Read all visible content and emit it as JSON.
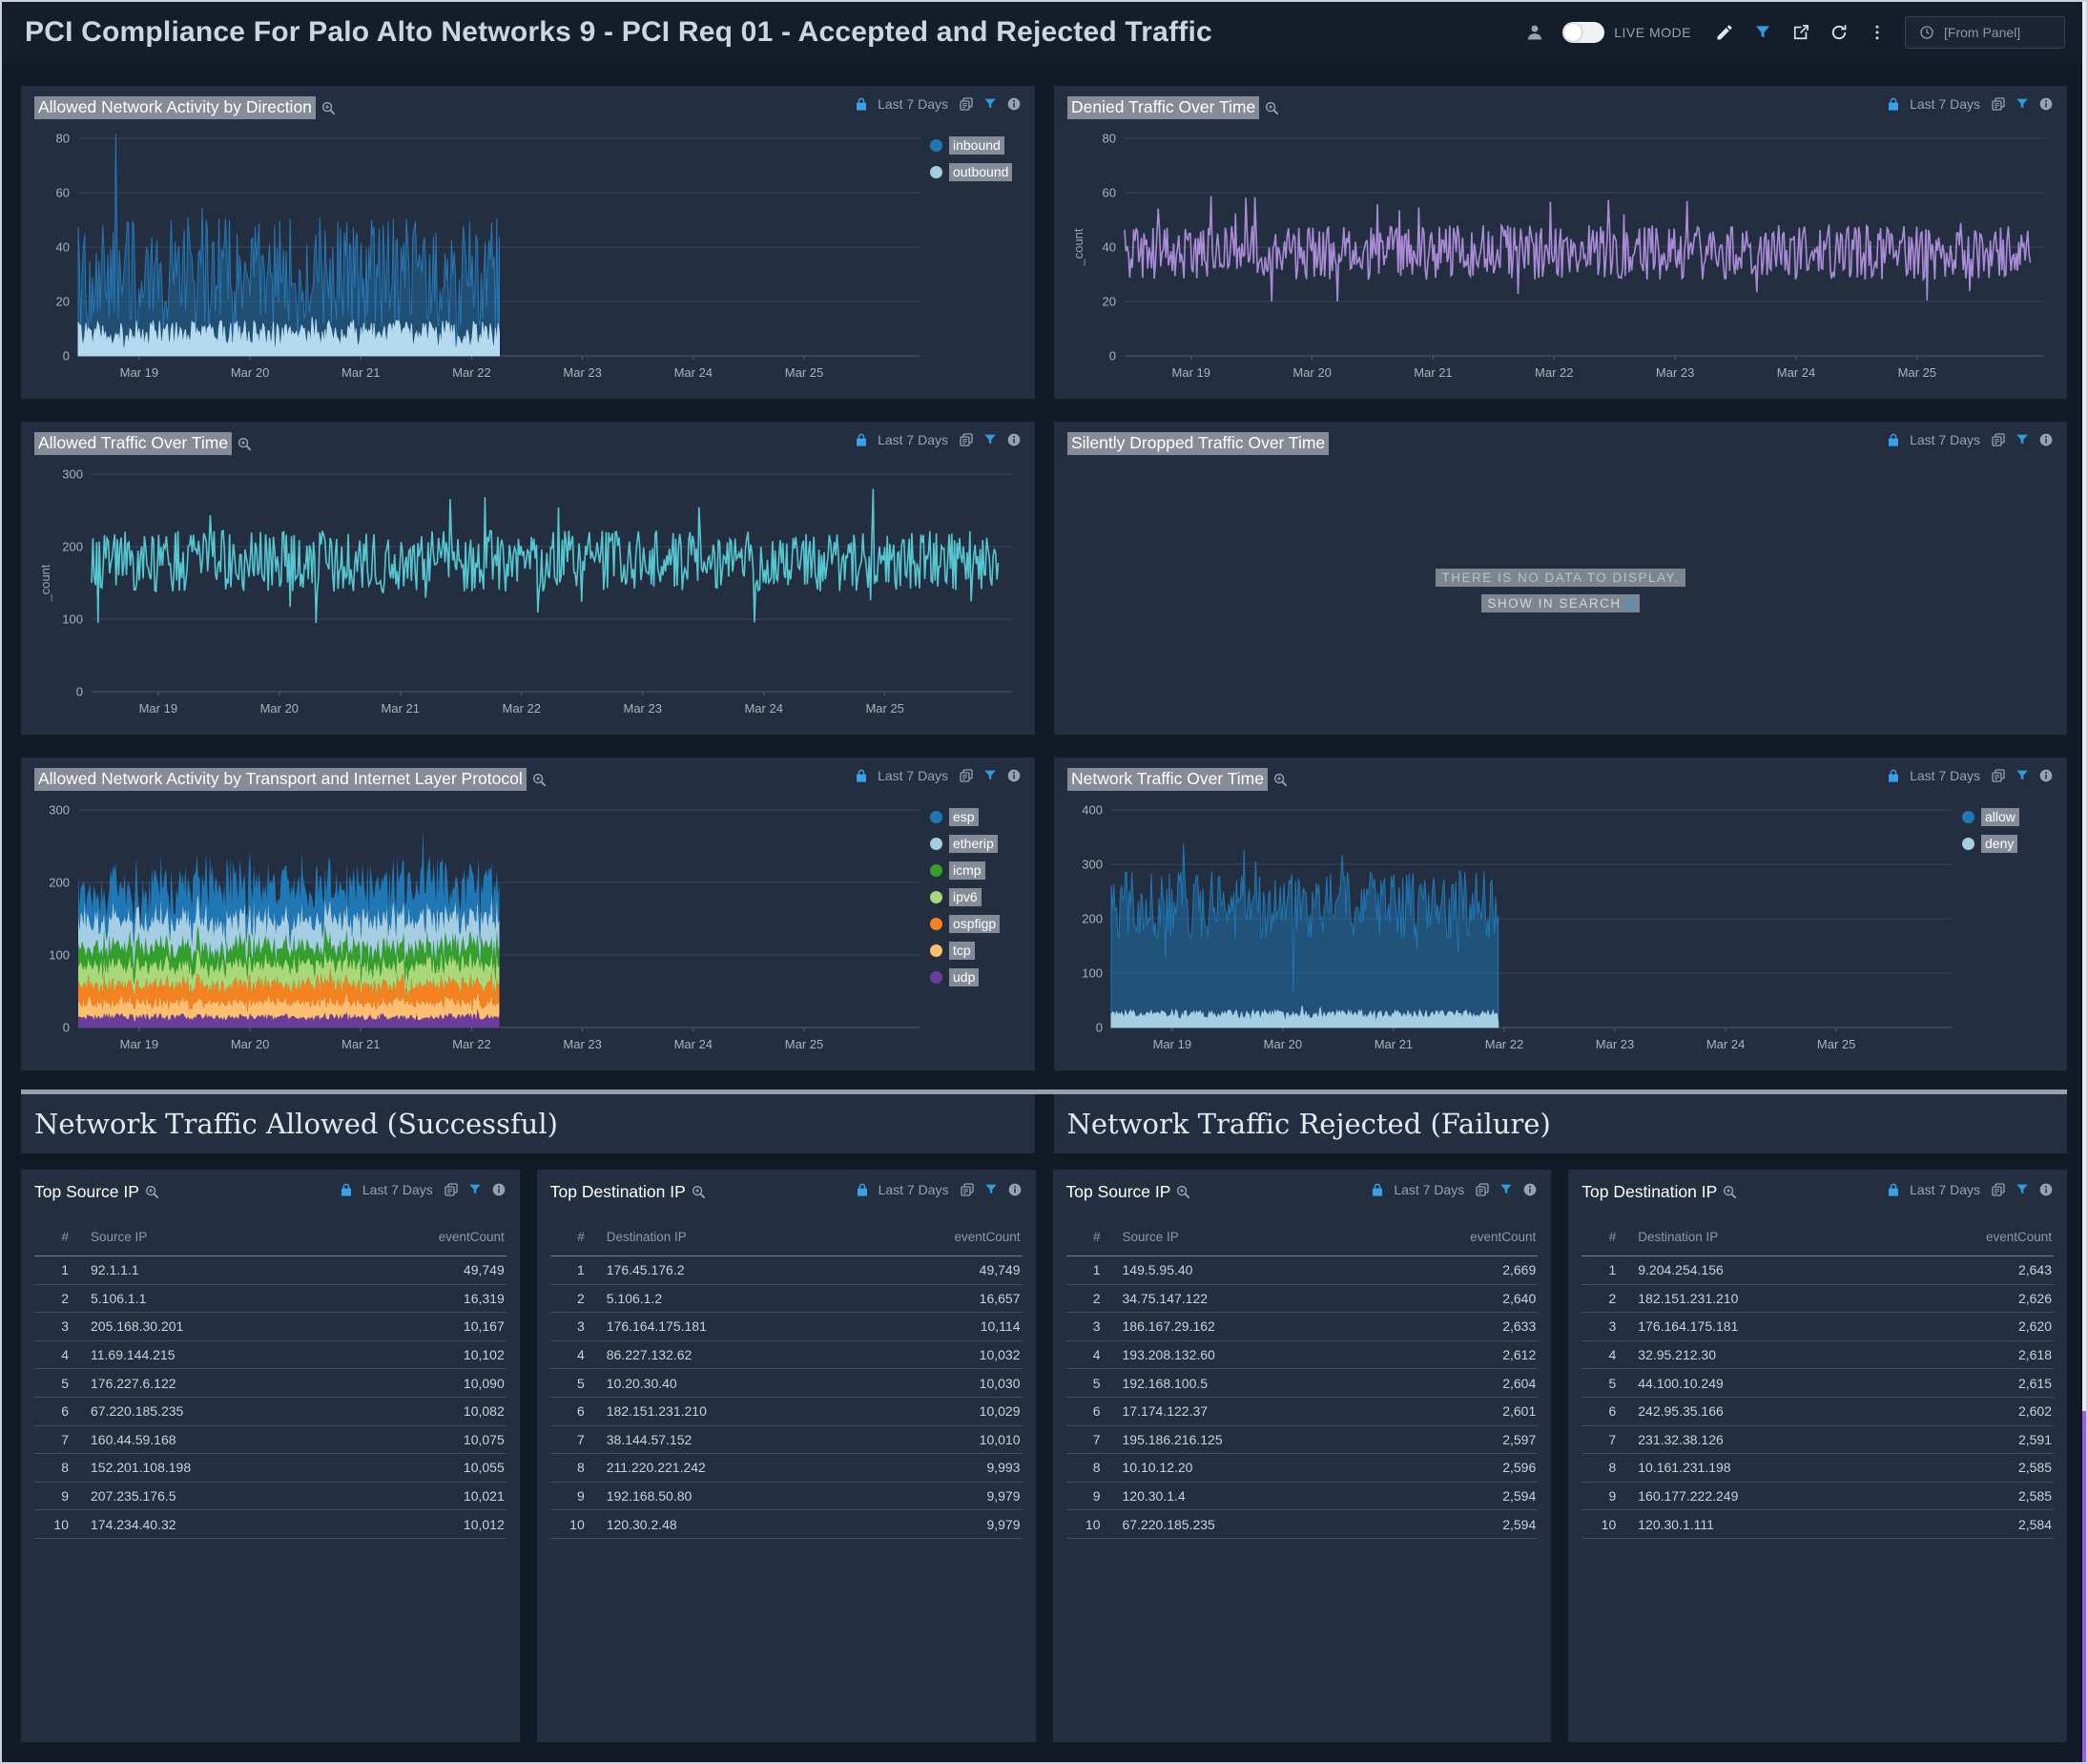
{
  "header": {
    "title": "PCI Compliance For Palo Alto Networks 9 - PCI Req 01 - Accepted and Rejected Traffic",
    "live_mode_label": "LIVE MODE",
    "time_input": "[From Panel]"
  },
  "theme": {
    "page_bg": "#121a27",
    "panel_bg": "#232e40",
    "accent_blue": "#2f9ee0",
    "highlight_gray": "#858c97",
    "scrollbar_thumb": "#9e5ce0"
  },
  "section_headers": [
    "Network Traffic Allowed (Successful)",
    "Network Traffic Rejected (Failure)"
  ],
  "chart_data": [
    {
      "title": "Allowed Network Activity by Direction",
      "time_range": "Last 7 Days",
      "type": "area",
      "x_ticks": [
        "Mar 19",
        "Mar 20",
        "Mar 21",
        "Mar 22",
        "Mar 23",
        "Mar 24",
        "Mar 25"
      ],
      "ylim": [
        0,
        80
      ],
      "yticks": [
        0,
        20,
        40,
        60,
        80
      ],
      "ylabel": "",
      "data_end_frac": 0.5,
      "note": "noisy traffic counts, data present Mar 19 through Mar 22 only, values mostly 5-65",
      "legend": [
        {
          "label": "inbound",
          "color": "#1f78b4"
        },
        {
          "label": "outbound",
          "color": "#a6cee3"
        }
      ],
      "render": "layers",
      "series": [
        {
          "name": "inbound",
          "style": "area",
          "color": "#2577b5",
          "fill": "rgba(31,120,180,0.45)",
          "mean": 30,
          "amp": 21,
          "min": 5,
          "seed": 11
        },
        {
          "name": "outbound",
          "style": "area",
          "color": "#b5d9ef",
          "fill": "#b5d9ef",
          "mean": 8,
          "amp": 5,
          "min": 2,
          "seed": 22
        }
      ]
    },
    {
      "title": "Denied Traffic Over Time",
      "time_range": "Last 7 Days",
      "type": "line",
      "x_ticks": [
        "Mar 19",
        "Mar 20",
        "Mar 21",
        "Mar 22",
        "Mar 23",
        "Mar 24",
        "Mar 25"
      ],
      "ylim": [
        0,
        80
      ],
      "yticks": [
        0,
        20,
        40,
        60,
        80
      ],
      "ylabel": "_count",
      "data_end_frac": 0.985,
      "note": "noisy purple line across full week, values mostly 20-65, mean ~38",
      "legend": [],
      "render": "layers",
      "series": [
        {
          "name": "_count",
          "style": "line",
          "color": "#a98bd6",
          "width": 1.6,
          "mean": 38,
          "amp": 10,
          "min": 20,
          "seed": 33
        }
      ]
    },
    {
      "title": "Allowed Traffic Over Time",
      "time_range": "Last 7 Days",
      "type": "line",
      "x_ticks": [
        "Mar 19",
        "Mar 20",
        "Mar 21",
        "Mar 22",
        "Mar 23",
        "Mar 24",
        "Mar 25"
      ],
      "ylim": [
        0,
        300
      ],
      "yticks": [
        0,
        100,
        200,
        300
      ],
      "ylabel": "_count",
      "data_end_frac": 0.985,
      "note": "noisy teal line across full week, values mostly 100-280, mean ~180",
      "legend": [],
      "render": "layers",
      "series": [
        {
          "name": "_count",
          "style": "line",
          "color": "#56c7d1",
          "width": 1.6,
          "mean": 180,
          "amp": 42,
          "min": 95,
          "seed": 44
        }
      ]
    },
    {
      "title": "Silently Dropped Traffic Over Time",
      "time_range": "Last 7 Days",
      "type": "none",
      "no_data": {
        "message": "THERE IS NO DATA TO DISPLAY.",
        "link": "SHOW IN SEARCH"
      }
    },
    {
      "title": "Allowed Network Activity by Transport and Internet Layer Protocol",
      "time_range": "Last 7 Days",
      "type": "area",
      "x_ticks": [
        "Mar 19",
        "Mar 20",
        "Mar 21",
        "Mar 22",
        "Mar 23",
        "Mar 24",
        "Mar 25"
      ],
      "ylim": [
        0,
        300
      ],
      "yticks": [
        0,
        100,
        200,
        300
      ],
      "ylabel": "",
      "data_end_frac": 0.5,
      "note": "stacked protocol layers, data present Mar 19 through Mar 22 only, stacked total ~150-290",
      "legend": [
        {
          "label": "esp",
          "color": "#1f78b4"
        },
        {
          "label": "etherip",
          "color": "#a6cee3"
        },
        {
          "label": "icmp",
          "color": "#33a02c"
        },
        {
          "label": "ipv6",
          "color": "#a8d878"
        },
        {
          "label": "ospfigp",
          "color": "#f5821f"
        },
        {
          "label": "tcp",
          "color": "#fdbf6f"
        },
        {
          "label": "udp",
          "color": "#6a3d9a"
        }
      ],
      "render": "stack",
      "series": [
        {
          "name": "udp",
          "color": "#6a3d9a",
          "mean": 15,
          "amp": 5,
          "seed": 51
        },
        {
          "name": "tcp",
          "color": "#fdbf6f",
          "mean": 20,
          "amp": 7,
          "seed": 52
        },
        {
          "name": "ospfigp",
          "color": "#f5821f",
          "mean": 25,
          "amp": 9,
          "seed": 53
        },
        {
          "name": "ipv6",
          "color": "#a8d878",
          "mean": 27,
          "amp": 9,
          "seed": 54
        },
        {
          "name": "icmp",
          "color": "#33a02c",
          "mean": 25,
          "amp": 10,
          "seed": 55
        },
        {
          "name": "etherip",
          "color": "#a6cee3",
          "mean": 38,
          "amp": 13,
          "seed": 56
        },
        {
          "name": "esp",
          "color": "#1f78b4",
          "mean": 46,
          "amp": 26,
          "seed": 57
        }
      ]
    },
    {
      "title": "Network Traffic Over Time",
      "time_range": "Last 7 Days",
      "type": "area",
      "x_ticks": [
        "Mar 19",
        "Mar 20",
        "Mar 21",
        "Mar 22",
        "Mar 23",
        "Mar 24",
        "Mar 25"
      ],
      "ylim": [
        0,
        400
      ],
      "yticks": [
        0,
        100,
        200,
        300,
        400
      ],
      "ylabel": "",
      "data_end_frac": 0.46,
      "note": "blue allow area with light-blue deny band at bottom, data present Mar 19 through Mar 22 only, allow mostly 130-340",
      "legend": [
        {
          "label": "allow",
          "color": "#1f78b4"
        },
        {
          "label": "deny",
          "color": "#a6cee3"
        }
      ],
      "render": "layers",
      "series": [
        {
          "name": "allow",
          "style": "area",
          "color": "#1f78b4",
          "fill": "rgba(31,120,180,0.5)",
          "mean": 225,
          "amp": 62,
          "min": 45,
          "seed": 71
        },
        {
          "name": "deny",
          "style": "area",
          "color": "#a6cee3",
          "fill": "#a6cee3",
          "mean": 24,
          "amp": 8,
          "min": 8,
          "seed": 72
        }
      ]
    }
  ],
  "tables": [
    {
      "title": "Top Source IP",
      "time_range": "Last 7 Days",
      "columns": [
        "#",
        "Source IP",
        "eventCount"
      ],
      "rows": [
        [
          "1",
          "92.1.1.1",
          "49,749"
        ],
        [
          "2",
          "5.106.1.1",
          "16,319"
        ],
        [
          "3",
          "205.168.30.201",
          "10,167"
        ],
        [
          "4",
          "11.69.144.215",
          "10,102"
        ],
        [
          "5",
          "176.227.6.122",
          "10,090"
        ],
        [
          "6",
          "67.220.185.235",
          "10,082"
        ],
        [
          "7",
          "160.44.59.168",
          "10,075"
        ],
        [
          "8",
          "152.201.108.198",
          "10,055"
        ],
        [
          "9",
          "207.235.176.5",
          "10,021"
        ],
        [
          "10",
          "174.234.40.32",
          "10,012"
        ]
      ]
    },
    {
      "title": "Top Destination IP",
      "time_range": "Last 7 Days",
      "columns": [
        "#",
        "Destination IP",
        "eventCount"
      ],
      "rows": [
        [
          "1",
          "176.45.176.2",
          "49,749"
        ],
        [
          "2",
          "5.106.1.2",
          "16,657"
        ],
        [
          "3",
          "176.164.175.181",
          "10,114"
        ],
        [
          "4",
          "86.227.132.62",
          "10,032"
        ],
        [
          "5",
          "10.20.30.40",
          "10,030"
        ],
        [
          "6",
          "182.151.231.210",
          "10,029"
        ],
        [
          "7",
          "38.144.57.152",
          "10,010"
        ],
        [
          "8",
          "211.220.221.242",
          "9,993"
        ],
        [
          "9",
          "192.168.50.80",
          "9,979"
        ],
        [
          "10",
          "120.30.2.48",
          "9,979"
        ]
      ]
    },
    {
      "title": "Top Source IP",
      "time_range": "Last 7 Days",
      "columns": [
        "#",
        "Source IP",
        "eventCount"
      ],
      "rows": [
        [
          "1",
          "149.5.95.40",
          "2,669"
        ],
        [
          "2",
          "34.75.147.122",
          "2,640"
        ],
        [
          "3",
          "186.167.29.162",
          "2,633"
        ],
        [
          "4",
          "193.208.132.60",
          "2,612"
        ],
        [
          "5",
          "192.168.100.5",
          "2,604"
        ],
        [
          "6",
          "17.174.122.37",
          "2,601"
        ],
        [
          "7",
          "195.186.216.125",
          "2,597"
        ],
        [
          "8",
          "10.10.12.20",
          "2,596"
        ],
        [
          "9",
          "120.30.1.4",
          "2,594"
        ],
        [
          "10",
          "67.220.185.235",
          "2,594"
        ]
      ]
    },
    {
      "title": "Top Destination IP",
      "time_range": "Last 7 Days",
      "columns": [
        "#",
        "Destination IP",
        "eventCount"
      ],
      "rows": [
        [
          "1",
          "9.204.254.156",
          "2,643"
        ],
        [
          "2",
          "182.151.231.210",
          "2,626"
        ],
        [
          "3",
          "176.164.175.181",
          "2,620"
        ],
        [
          "4",
          "32.95.212.30",
          "2,618"
        ],
        [
          "5",
          "44.100.10.249",
          "2,615"
        ],
        [
          "6",
          "242.95.35.166",
          "2,602"
        ],
        [
          "7",
          "231.32.38.126",
          "2,591"
        ],
        [
          "8",
          "10.161.231.198",
          "2,585"
        ],
        [
          "9",
          "160.177.222.249",
          "2,585"
        ],
        [
          "10",
          "120.30.1.111",
          "2,584"
        ]
      ]
    }
  ]
}
